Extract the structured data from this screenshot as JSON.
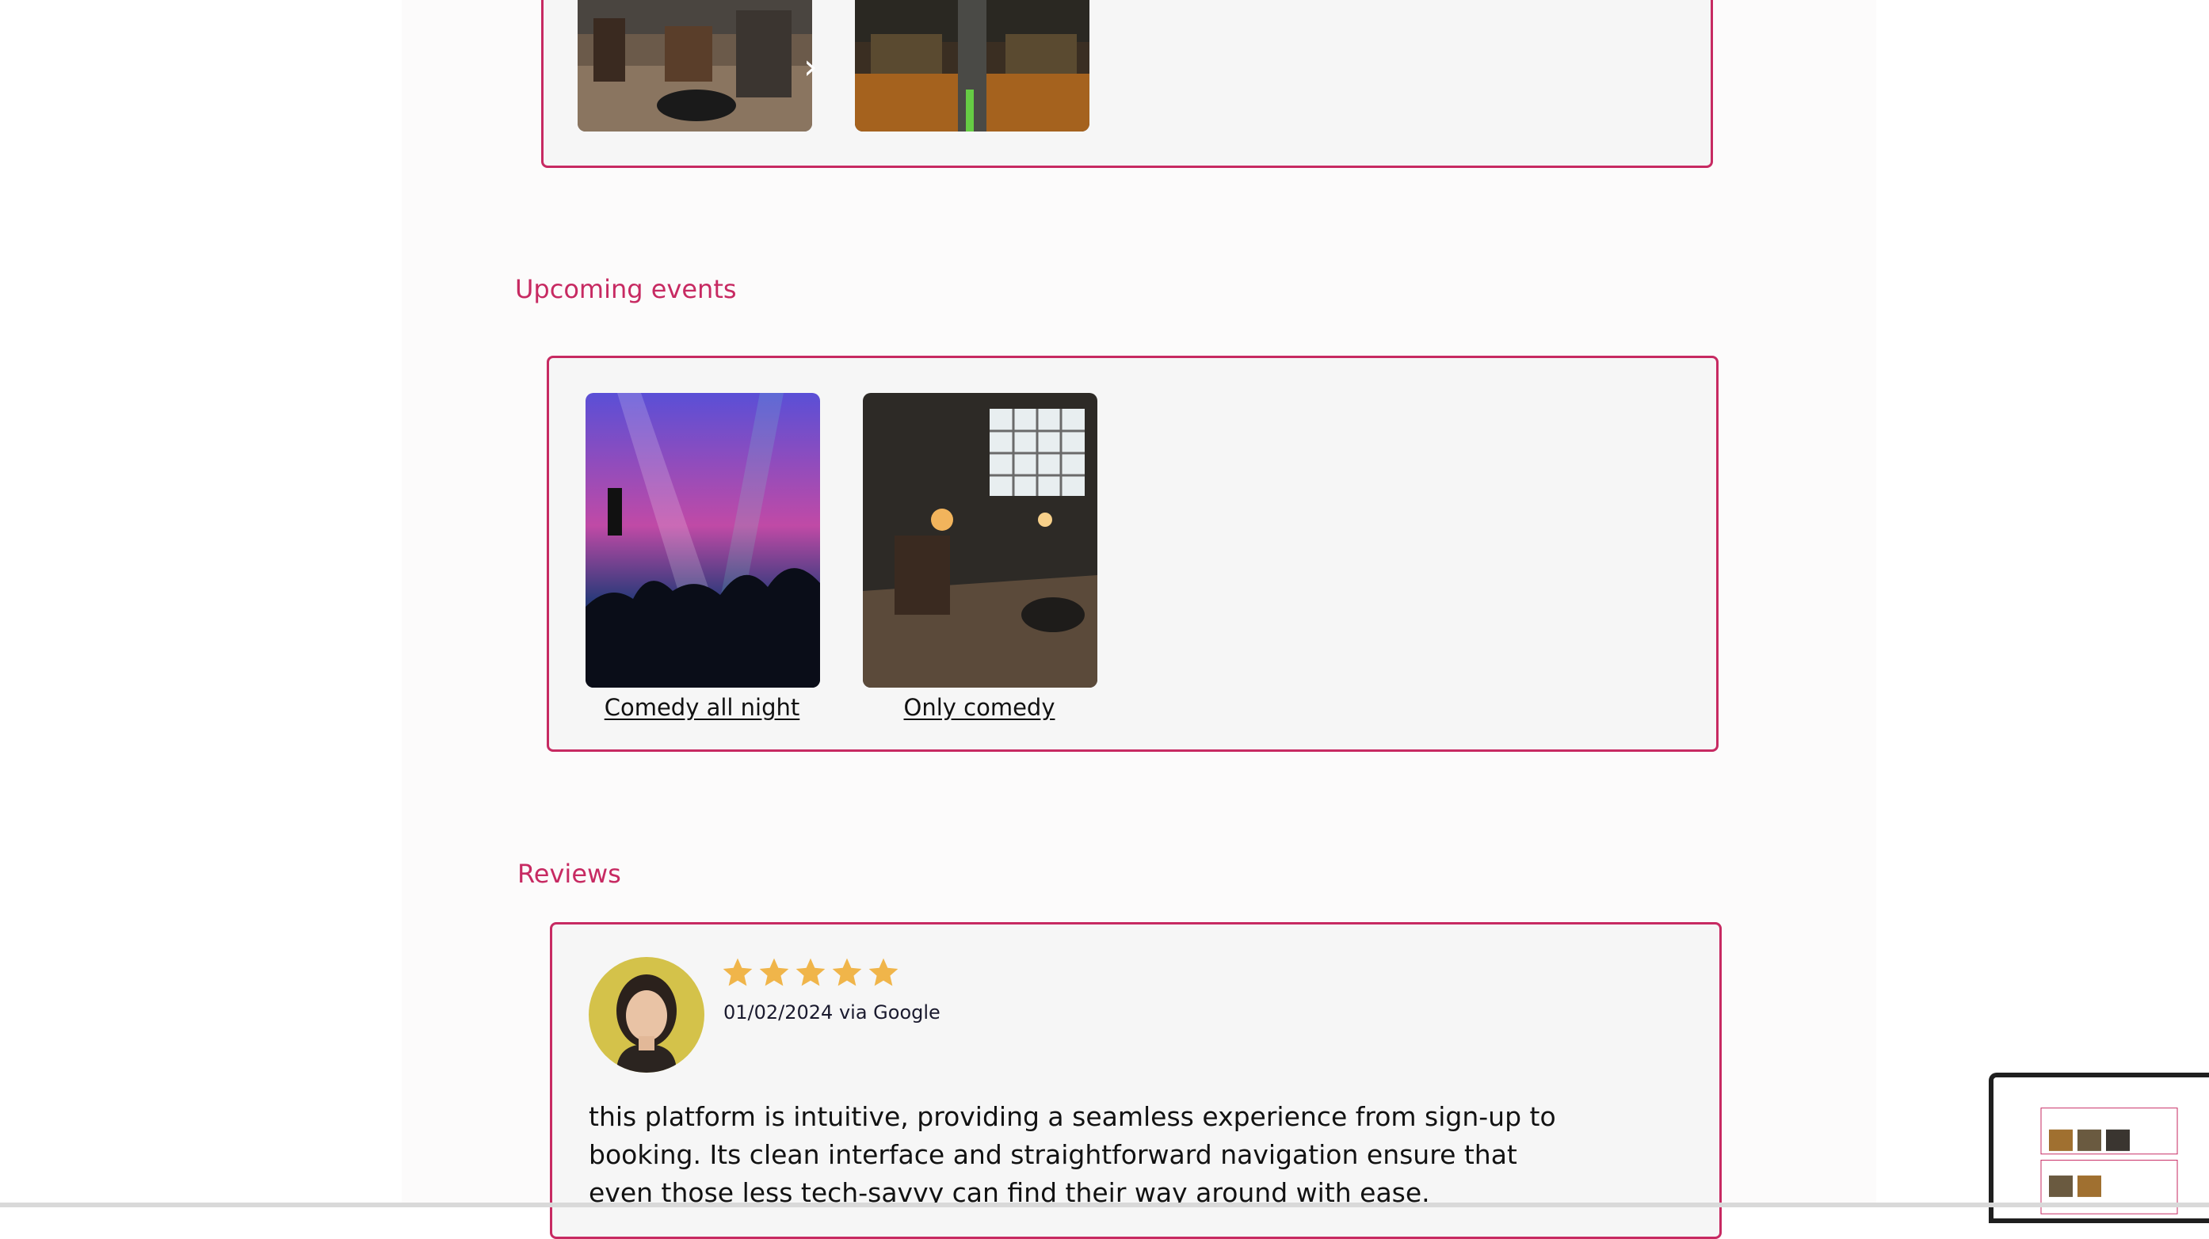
{
  "gallery": {
    "images": [
      {
        "name": "restaurant-interior-image"
      },
      {
        "name": "bar-interior-image"
      }
    ],
    "next_glyph": "›"
  },
  "events": {
    "title": "Upcoming events",
    "items": [
      {
        "title": "Comedy all night"
      },
      {
        "title": "Only comedy"
      }
    ]
  },
  "reviews": {
    "title": "Reviews",
    "items": [
      {
        "rating": 5,
        "rating_max": 5,
        "date_source": "01/02/2024 via Google",
        "text": "this platform is intuitive, providing a seamless experience from sign-up to booking. Its clean interface and straightforward navigation ensure that even those less tech-savvy can find their way around with ease."
      }
    ]
  },
  "colors": {
    "accent": "#c72a62",
    "card_bg": "#f6f6f6",
    "star": "#f0b54a"
  }
}
